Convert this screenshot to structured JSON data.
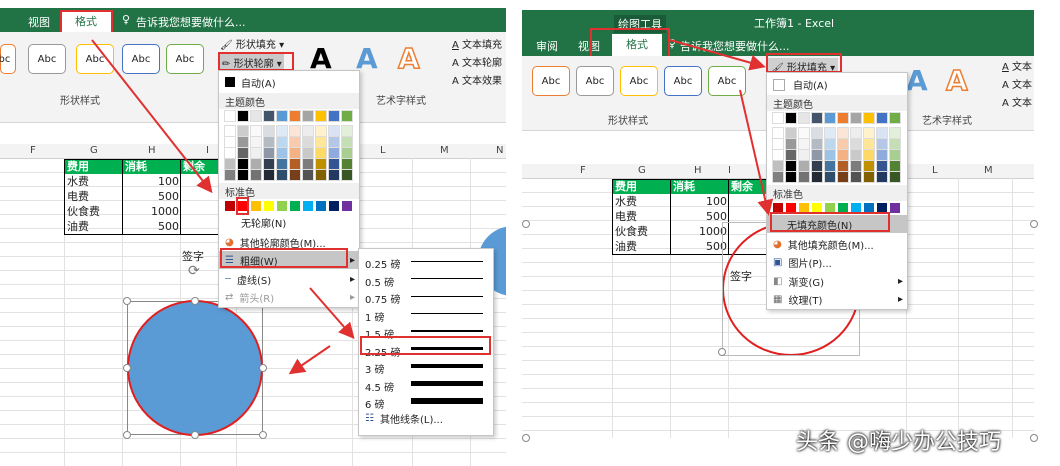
{
  "left": {
    "tabs": [
      "视图",
      "格式"
    ],
    "tell_me": "告诉我您想要做什么...",
    "shape_fill": "形状填充",
    "shape_outline": "形状轮廓",
    "text_fill": "文本填充",
    "text_outline": "文本轮廓",
    "text_effect": "文本效果",
    "style_sample": "Abc",
    "group_shape_styles": "形状样式",
    "group_art_styles": "艺术字样式",
    "columns": [
      "F",
      "G",
      "H",
      "I",
      "L",
      "M",
      "N"
    ],
    "table": {
      "headers": [
        "费用",
        "消耗",
        "剩余"
      ],
      "rows": [
        [
          "水费",
          "100"
        ],
        [
          "电费",
          "500"
        ],
        [
          "伙食费",
          "1000"
        ],
        [
          "油费",
          "500"
        ]
      ]
    },
    "sign_label": "签字",
    "outline_menu": {
      "auto": "自动(A)",
      "theme_colors": "主题颜色",
      "standard_colors": "标准色",
      "no_outline": "无轮廓(N)",
      "more_colors": "其他轮廓颜色(M)...",
      "weight": "粗细(W)",
      "dashes": "虚线(S)",
      "arrows": "箭头(R)"
    },
    "weights": {
      "labels": [
        "0.25 磅",
        "0.5 磅",
        "0.75 磅",
        "1 磅",
        "1.5 磅",
        "2.25 磅",
        "3 磅",
        "4.5 磅",
        "6 磅"
      ],
      "values": [
        0.25,
        0.5,
        0.75,
        1,
        1.5,
        2.25,
        3,
        4.5,
        6
      ],
      "more": "其他线条(L)..."
    }
  },
  "right": {
    "context_label": "绘图工具",
    "window_title": "工作簿1 - Excel",
    "tabs": [
      "审阅",
      "视图",
      "格式"
    ],
    "tell_me": "告诉我您想要做什么...",
    "shape_fill": "形状填充",
    "text_short": "文本",
    "style_sample": "Abc",
    "group_shape_styles": "形状样式",
    "group_art_styles": "艺术字样式",
    "columns": [
      "F",
      "G",
      "H",
      "I",
      "L",
      "M"
    ],
    "table": {
      "headers": [
        "费用",
        "消耗",
        "剩余"
      ],
      "rows": [
        [
          "水费",
          "100"
        ],
        [
          "电费",
          "500"
        ],
        [
          "伙食费",
          "1000"
        ],
        [
          "油费",
          "500"
        ]
      ]
    },
    "sign_label": "签字",
    "fill_menu": {
      "auto": "自动(A)",
      "theme_colors": "主题颜色",
      "standard_colors": "标准色",
      "no_fill": "无填充颜色(N)",
      "more_colors": "其他填充颜色(M)...",
      "picture": "图片(P)...",
      "gradient": "渐变(G)",
      "texture": "纹理(T)"
    }
  },
  "watermark": "头条 @嗨少办公技巧",
  "colors": {
    "excel_green": "#217346",
    "highlight_red": "#e03030",
    "circle_fill": "#5b9bd5",
    "circle_outline": "#e02020",
    "theme": [
      "#ffffff",
      "#000000",
      "#e7e6e6",
      "#44546a",
      "#5b9bd5",
      "#ed7d31",
      "#a5a5a5",
      "#ffc000",
      "#4472c4",
      "#70ad47"
    ],
    "standard": [
      "#c00000",
      "#ff0000",
      "#ffc000",
      "#ffff00",
      "#92d050",
      "#00b050",
      "#00b0f0",
      "#0070c0",
      "#002060",
      "#7030a0"
    ]
  }
}
